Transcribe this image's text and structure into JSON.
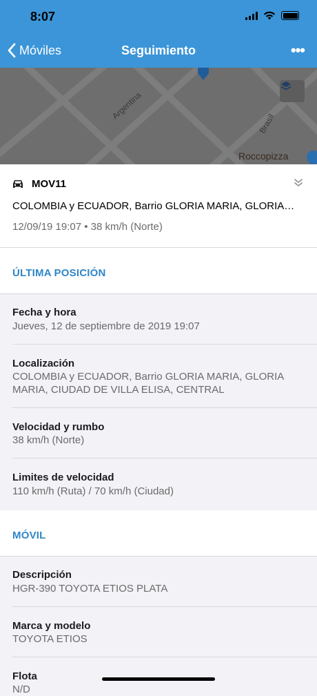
{
  "status_bar": {
    "time": "8:07"
  },
  "nav": {
    "back_label": "Móviles",
    "title": "Seguimiento",
    "more_label": "•••"
  },
  "map": {
    "street_1": "Argentina",
    "street_2": "Brasil",
    "poi": "Roccopizza"
  },
  "vehicle": {
    "name": "MOV11",
    "address": "COLOMBIA y ECUADOR, Barrio GLORIA MARIA, GLORIA…",
    "meta": "12/09/19 19:07 • 38 km/h (Norte)"
  },
  "sections": {
    "last_position": {
      "title": "ÚLTIMA POSICIÓN",
      "items": [
        {
          "label": "Fecha y hora",
          "value": "Jueves, 12 de septiembre de 2019 19:07"
        },
        {
          "label": "Localización",
          "value": "COLOMBIA y ECUADOR, Barrio GLORIA MARIA, GLORIA MARIA, CIUDAD DE VILLA ELISA, CENTRAL"
        },
        {
          "label": "Velocidad y rumbo",
          "value": "38 km/h (Norte)"
        },
        {
          "label": "Limites de velocidad",
          "value": "110 km/h (Ruta) / 70 km/h (Ciudad)"
        }
      ]
    },
    "mobile": {
      "title": "MÓVIL",
      "items": [
        {
          "label": "Descripción",
          "value": "HGR-390 TOYOTA ETIOS PLATA"
        },
        {
          "label": "Marca y modelo",
          "value": "TOYOTA ETIOS"
        },
        {
          "label": "Flota",
          "value": "N/D"
        }
      ]
    }
  }
}
